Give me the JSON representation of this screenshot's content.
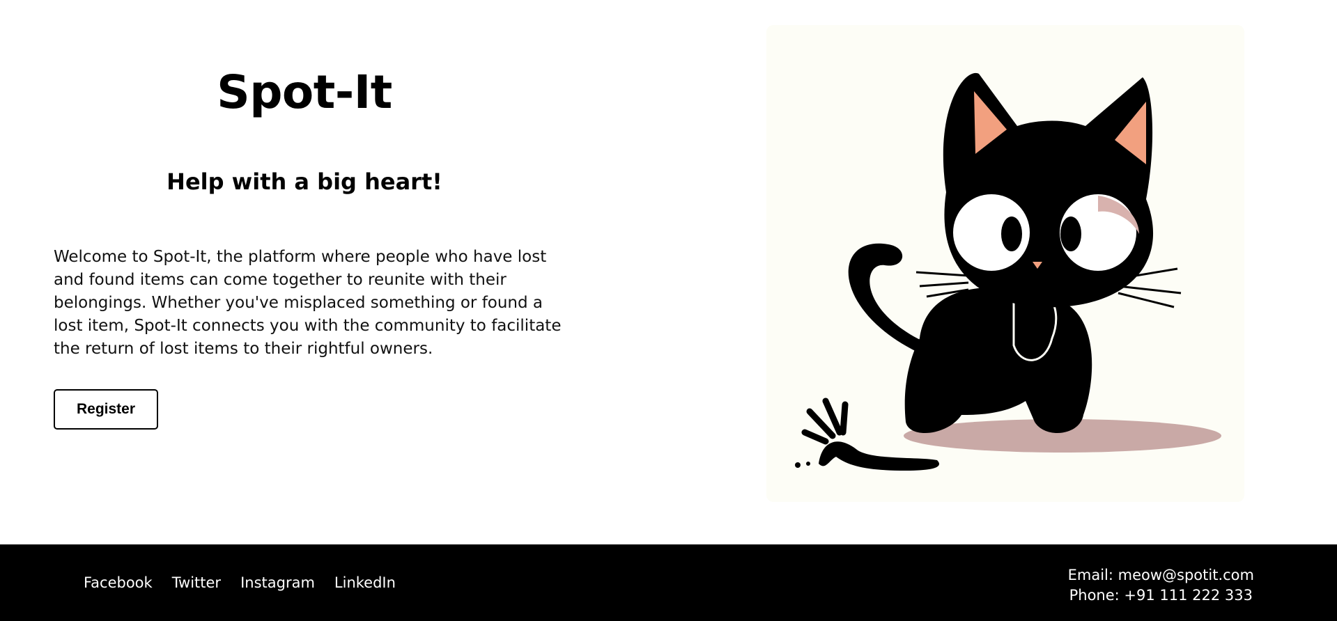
{
  "hero": {
    "title": "Spot-It",
    "tagline": "Help with a big heart!",
    "intro": "Welcome to Spot-It, the platform where people who have lost and found items can come together to reunite with their belongings. Whether you've misplaced something or found a lost item, Spot-It connects you with the community to facilitate the return of lost items to their rightful owners.",
    "register_label": "Register"
  },
  "illustration": {
    "icon": "black-cat-illustration",
    "background": "#fdfdf6",
    "cat_color": "#000000",
    "ear_inner_color": "#f2a07f",
    "shadow_color": "#c9a9a6"
  },
  "footer": {
    "social_links": [
      "Facebook",
      "Twitter",
      "Instagram",
      "LinkedIn"
    ],
    "email": "Email: meow@spotit.com",
    "phone": "Phone: +91 111 222 333"
  }
}
